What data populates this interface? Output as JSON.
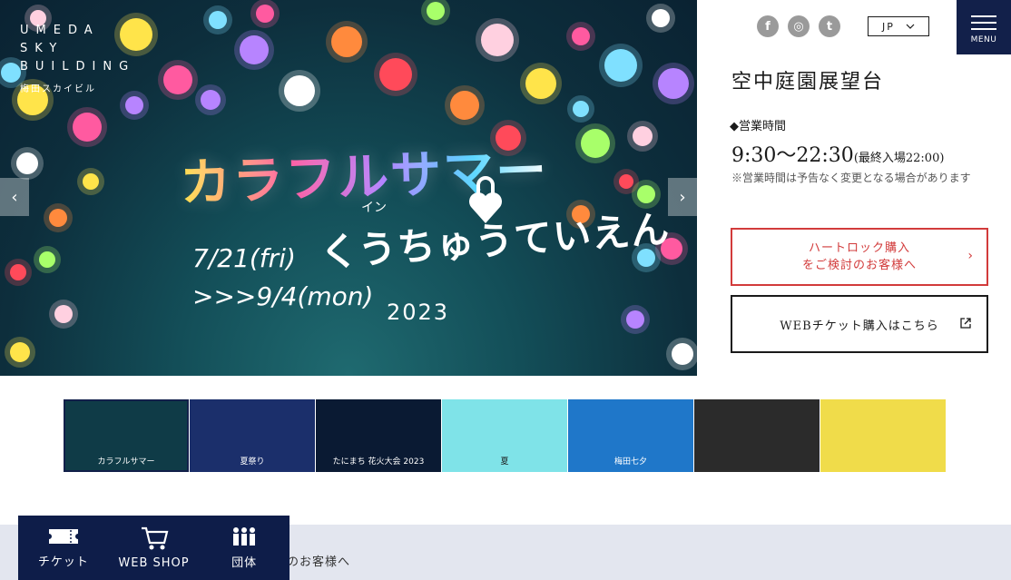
{
  "logo": {
    "lines": [
      "UMEDA",
      "SKY",
      "BUILDING"
    ],
    "subtitle": "梅田スカイビル"
  },
  "hero": {
    "title": "カラフルサマー",
    "subtitle": "くうちゅうていえん",
    "subtitle_small": "イン",
    "date_start": "7/21(fri)",
    "date_end": ">>>9/4(mon)",
    "year": "2023",
    "prev_arrow": "‹",
    "next_arrow": "›"
  },
  "header": {
    "social": [
      {
        "name": "facebook-icon",
        "glyph": "f"
      },
      {
        "name": "instagram-icon",
        "glyph": "◎"
      },
      {
        "name": "twitter-icon",
        "glyph": "t"
      }
    ],
    "language": "JP",
    "menu_label": "MENU"
  },
  "facility": {
    "title": "空中庭園展望台",
    "hours_heading": "◆営業時間",
    "hours_main": "9:30〜22:30",
    "hours_last": "(最終入場22:00)",
    "hours_note": "※営業時間は予告なく変更となる場合があります"
  },
  "buttons": {
    "heartlock_line1": "ハートロック購入",
    "heartlock_line2": "をご検討のお客様へ",
    "heartlock_arrow": "›",
    "web_ticket": "WEBチケット購入はこちら"
  },
  "thumbnails": [
    {
      "caption": "カラフルサマー",
      "bg": "#0f3b47"
    },
    {
      "caption": "夏祭り",
      "bg": "#1b2f6b"
    },
    {
      "caption": "たにまち 花火大会 2023",
      "bg": "#0a1a33"
    },
    {
      "caption": "夏",
      "bg": "#7fe3e8"
    },
    {
      "caption": "梅田七夕",
      "bg": "#1f77c9"
    },
    {
      "caption": "",
      "bg": "#2b2b2b"
    },
    {
      "caption": "",
      "bg": "#f0dc4a"
    }
  ],
  "bottom_nav": [
    {
      "label": "チケット",
      "icon": "ticket-icon"
    },
    {
      "label": "WEB SHOP",
      "icon": "cart-icon"
    },
    {
      "label": "団体",
      "icon": "group-icon"
    }
  ],
  "info_band_text": "のお客様へ",
  "colors": {
    "navy": "#12204a",
    "heartlock_red": "#d23b3b"
  }
}
